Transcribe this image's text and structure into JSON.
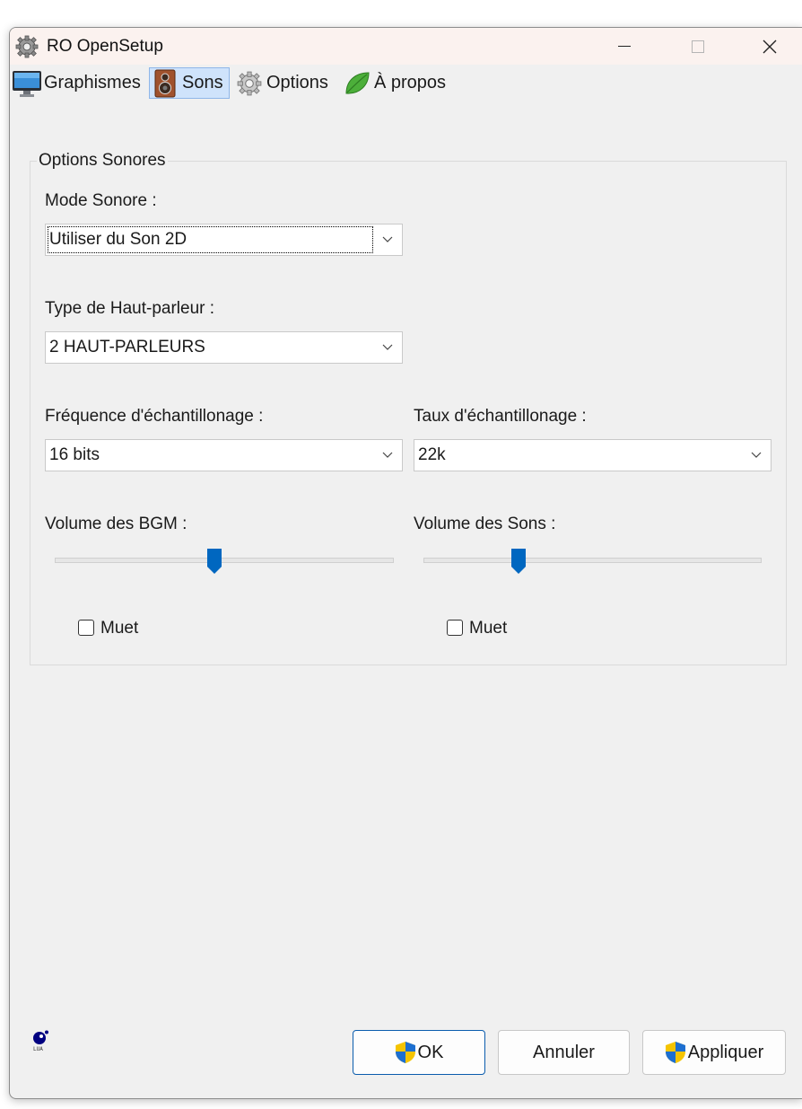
{
  "window": {
    "title": "RO OpenSetup"
  },
  "tabs": [
    {
      "label": "Graphismes",
      "icon": "monitor-icon"
    },
    {
      "label": "Sons",
      "icon": "speaker-icon",
      "active": true
    },
    {
      "label": "Options",
      "icon": "gear-icon"
    },
    {
      "label": "À propos",
      "icon": "leaf-icon"
    }
  ],
  "sound_options": {
    "group_title": "Options Sonores",
    "mode_label": "Mode Sonore :",
    "mode_value": "Utiliser du Son 2D",
    "speaker_label": "Type de Haut-parleur :",
    "speaker_value": "2 HAUT-PARLEURS",
    "frequency_label": "Fréquence d'échantillonage :",
    "frequency_value": "16 bits",
    "rate_label": "Taux d'échantillonage :",
    "rate_value": "22k",
    "bgm_volume_label": "Volume des BGM :",
    "bgm_volume_level": 0.47,
    "bgm_mute_label": "Muet",
    "bgm_mute_checked": false,
    "sound_volume_label": "Volume des Sons :",
    "sound_volume_level": 0.28,
    "sound_mute_label": "Muet",
    "sound_mute_checked": false
  },
  "buttons": {
    "ok": "OK",
    "cancel": "Annuler",
    "apply": "Appliquer"
  },
  "colors": {
    "accent": "#0067c0",
    "tab_active_bg": "#cfe3fb",
    "titlebar_bg": "#fbf2ef"
  }
}
